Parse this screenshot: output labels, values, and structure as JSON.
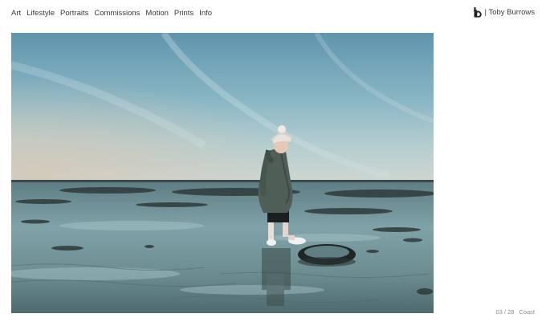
{
  "nav": {
    "items": [
      {
        "label": "Art"
      },
      {
        "label": "Lifestyle"
      },
      {
        "label": "Portraits"
      },
      {
        "label": "Commissions"
      },
      {
        "label": "Motion"
      },
      {
        "label": "Prints"
      },
      {
        "label": "Info"
      }
    ]
  },
  "brand": {
    "name": "| Toby Burrows",
    "logo_icon": "tb-monogram-icon"
  },
  "gallery": {
    "counter": "03 / 28",
    "title": "Coast"
  },
  "colors": {
    "text": "#3a3a3a",
    "muted": "#8a8a8a",
    "background": "#ffffff"
  }
}
